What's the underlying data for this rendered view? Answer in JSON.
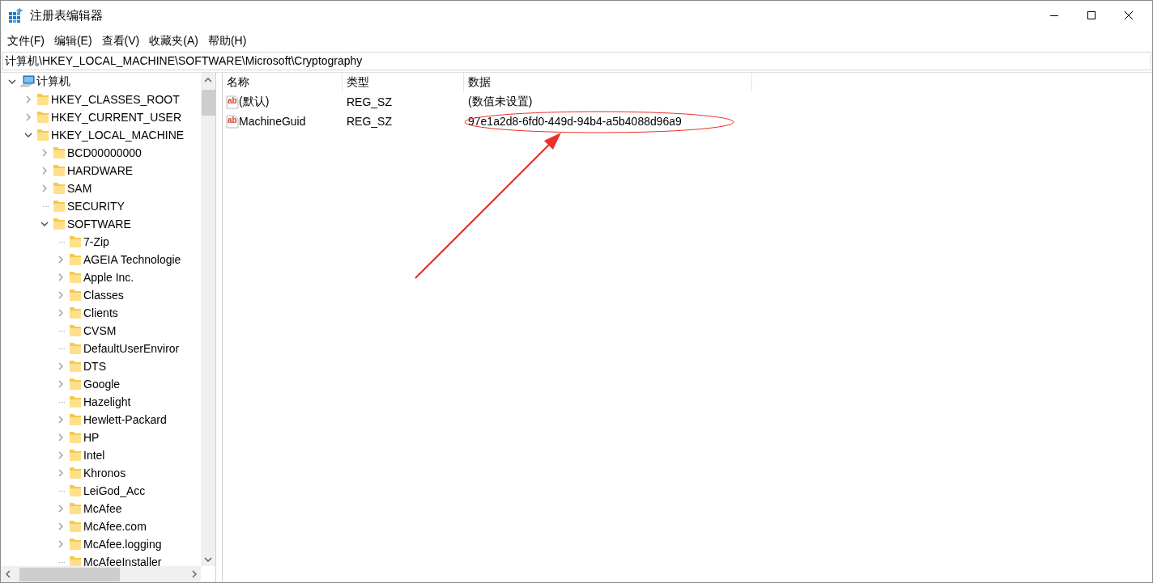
{
  "window": {
    "title": "注册表编辑器"
  },
  "menu": [
    "文件(F)",
    "编辑(E)",
    "查看(V)",
    "收藏夹(A)",
    "帮助(H)"
  ],
  "address": "计算机\\HKEY_LOCAL_MACHINE\\SOFTWARE\\Microsoft\\Cryptography",
  "tree": [
    {
      "label": "计算机",
      "kind": "computer",
      "expandable": true,
      "expanded": true,
      "children": [
        {
          "label": "HKEY_CLASSES_ROOT",
          "kind": "folder",
          "expandable": true,
          "expanded": false
        },
        {
          "label": "HKEY_CURRENT_USER",
          "kind": "folder",
          "expandable": true,
          "expanded": false
        },
        {
          "label": "HKEY_LOCAL_MACHINE",
          "kind": "folder",
          "expandable": true,
          "expanded": true,
          "children": [
            {
              "label": "BCD00000000",
              "kind": "folder",
              "expandable": true,
              "expanded": false
            },
            {
              "label": "HARDWARE",
              "kind": "folder",
              "expandable": true,
              "expanded": false
            },
            {
              "label": "SAM",
              "kind": "folder",
              "expandable": true,
              "expanded": false
            },
            {
              "label": "SECURITY",
              "kind": "folder",
              "expandable": false
            },
            {
              "label": "SOFTWARE",
              "kind": "folder",
              "expandable": true,
              "expanded": true,
              "children": [
                {
                  "label": "7-Zip",
                  "kind": "folder",
                  "expandable": false
                },
                {
                  "label": "AGEIA Technologie",
                  "kind": "folder",
                  "expandable": true,
                  "expanded": false
                },
                {
                  "label": "Apple Inc.",
                  "kind": "folder",
                  "expandable": true,
                  "expanded": false
                },
                {
                  "label": "Classes",
                  "kind": "folder",
                  "expandable": true,
                  "expanded": false
                },
                {
                  "label": "Clients",
                  "kind": "folder",
                  "expandable": true,
                  "expanded": false
                },
                {
                  "label": "CVSM",
                  "kind": "folder",
                  "expandable": false
                },
                {
                  "label": "DefaultUserEnviror",
                  "kind": "folder",
                  "expandable": false
                },
                {
                  "label": "DTS",
                  "kind": "folder",
                  "expandable": true,
                  "expanded": false
                },
                {
                  "label": "Google",
                  "kind": "folder",
                  "expandable": true,
                  "expanded": false
                },
                {
                  "label": "Hazelight",
                  "kind": "folder",
                  "expandable": false
                },
                {
                  "label": "Hewlett-Packard",
                  "kind": "folder",
                  "expandable": true,
                  "expanded": false
                },
                {
                  "label": "HP",
                  "kind": "folder",
                  "expandable": true,
                  "expanded": false
                },
                {
                  "label": "Intel",
                  "kind": "folder",
                  "expandable": true,
                  "expanded": false
                },
                {
                  "label": "Khronos",
                  "kind": "folder",
                  "expandable": true,
                  "expanded": false
                },
                {
                  "label": "LeiGod_Acc",
                  "kind": "folder",
                  "expandable": false
                },
                {
                  "label": "McAfee",
                  "kind": "folder",
                  "expandable": true,
                  "expanded": false
                },
                {
                  "label": "McAfee.com",
                  "kind": "folder",
                  "expandable": true,
                  "expanded": false
                },
                {
                  "label": "McAfee.logging",
                  "kind": "folder",
                  "expandable": true,
                  "expanded": false
                },
                {
                  "label": "McAfeeInstaller",
                  "kind": "folder",
                  "expandable": false
                }
              ]
            }
          ]
        }
      ]
    }
  ],
  "values": {
    "columns": [
      "名称",
      "类型",
      "数据"
    ],
    "rows": [
      {
        "icon": "ab",
        "name": "(默认)",
        "type": "REG_SZ",
        "data": "(数值未设置)",
        "highlighted": false
      },
      {
        "icon": "ab",
        "name": "MachineGuid",
        "type": "REG_SZ",
        "data": "97e1a2d8-6fd0-449d-94b4-a5b4088d96a9",
        "highlighted": true
      }
    ]
  }
}
